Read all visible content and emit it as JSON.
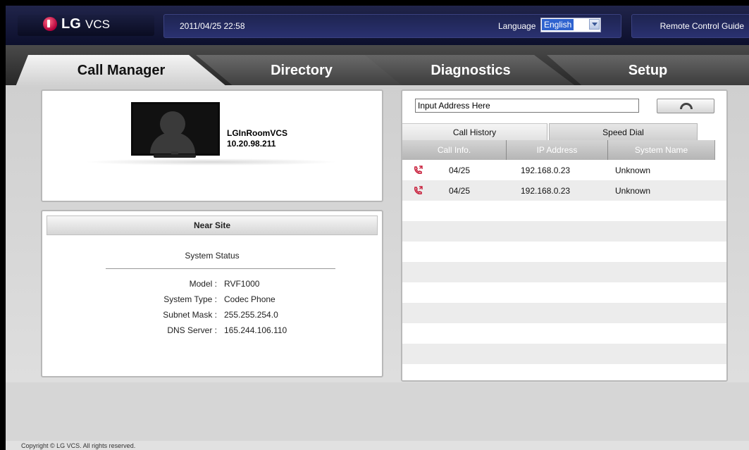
{
  "header": {
    "logo_brand": "LG",
    "logo_product": "VCS",
    "datetime": "2011/04/25 22:58",
    "language_label": "Language",
    "language_value": "English",
    "remote_control_guide": "Remote Control Guide"
  },
  "tabs": [
    {
      "label": "Call Manager",
      "active": true
    },
    {
      "label": "Directory",
      "active": false
    },
    {
      "label": "Diagnostics",
      "active": false
    },
    {
      "label": "Setup",
      "active": false
    }
  ],
  "profile": {
    "device_name": "LGInRoomVCS",
    "device_ip": "10.20.98.211"
  },
  "near_site": {
    "title": "Near Site",
    "section": "System Status",
    "rows": [
      {
        "label": "Model :",
        "value": "RVF1000"
      },
      {
        "label": "System Type :",
        "value": "Codec Phone"
      },
      {
        "label": "Subnet Mask :",
        "value": "255.255.254.0"
      },
      {
        "label": "DNS Server :",
        "value": "165.244.106.110"
      }
    ]
  },
  "call_panel": {
    "address_value": "Input Address Here",
    "subtabs": [
      "Call History",
      "Speed Dial"
    ],
    "columns": [
      "Call Info.",
      "IP Address",
      "System Name"
    ],
    "history": [
      {
        "date": "04/25",
        "ip": "192.168.0.23",
        "name": "Unknown"
      },
      {
        "date": "04/25",
        "ip": "192.168.0.23",
        "name": "Unknown"
      }
    ],
    "icon": "incoming-call-icon",
    "icon_color": "#c8203c"
  },
  "footer": {
    "copyright": "Copyright © LG VCS. All rights reserved."
  }
}
